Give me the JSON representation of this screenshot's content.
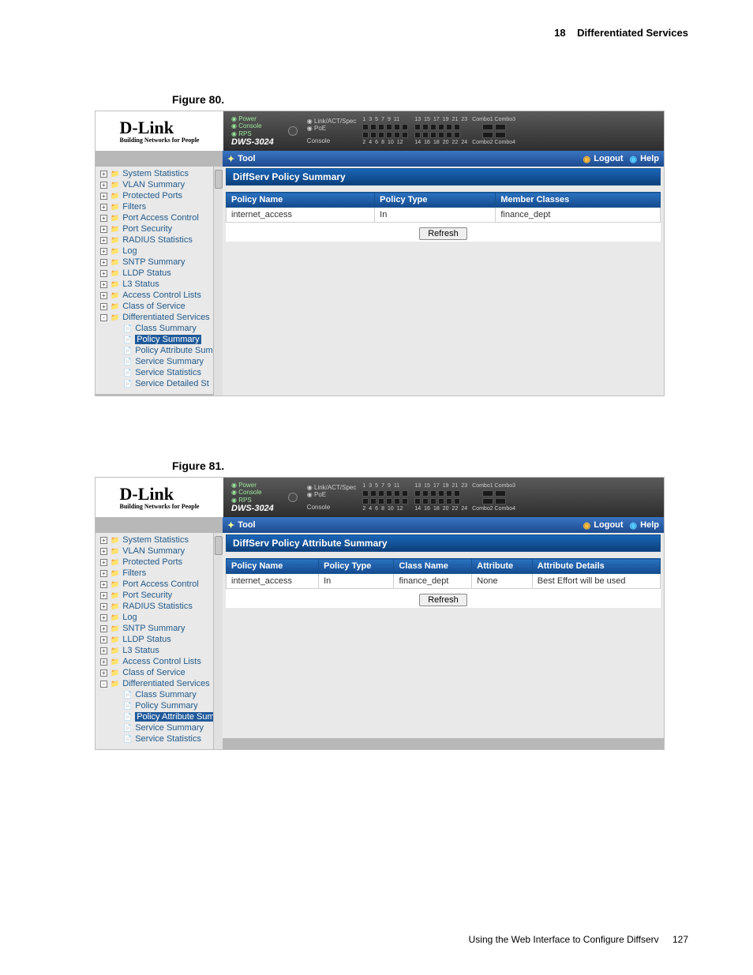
{
  "page": {
    "header_chapter_num": "18",
    "header_chapter_title": "Differentiated Services",
    "footer_text": "Using the Web Interface to Configure Diffserv",
    "footer_page": "127"
  },
  "figure80": {
    "caption": "Figure 80.",
    "brand": "D-Link",
    "tagline": "Building Networks for People",
    "model": "DWS-3024",
    "leds": {
      "power": "Power",
      "console_led": "Console",
      "rps": "RPS"
    },
    "status_col": {
      "link": "Link/ACT/Spec",
      "poe": "PoE",
      "console": "Console"
    },
    "port_row1": [
      "1",
      "3",
      "5",
      "7",
      "9",
      "11"
    ],
    "port_row2": [
      "2",
      "4",
      "6",
      "8",
      "10",
      "12"
    ],
    "port_row3": [
      "13",
      "15",
      "17",
      "19",
      "21",
      "23"
    ],
    "port_row4": [
      "14",
      "16",
      "18",
      "20",
      "22",
      "24"
    ],
    "combo1": "Combo1 Combo3",
    "combo2": "Combo2 Combo4",
    "toolbar": {
      "tool": "Tool",
      "logout": "Logout",
      "help": "Help"
    },
    "sidebar": [
      {
        "exp": "+",
        "label": "System Statistics"
      },
      {
        "exp": "+",
        "label": "VLAN Summary"
      },
      {
        "exp": "+",
        "label": "Protected Ports"
      },
      {
        "exp": "+",
        "label": "Filters"
      },
      {
        "exp": "+",
        "label": "Port Access Control"
      },
      {
        "exp": "+",
        "label": "Port Security"
      },
      {
        "exp": "+",
        "label": "RADIUS Statistics"
      },
      {
        "exp": "+",
        "label": "Log"
      },
      {
        "exp": "+",
        "label": "SNTP Summary"
      },
      {
        "exp": "+",
        "label": "LLDP Status"
      },
      {
        "exp": "+",
        "label": "L3 Status"
      },
      {
        "exp": "+",
        "label": "Access Control Lists"
      },
      {
        "exp": "+",
        "label": "Class of Service"
      },
      {
        "exp": "-",
        "label": "Differentiated Services"
      },
      {
        "exp": "",
        "label": "Class Summary",
        "child": true
      },
      {
        "exp": "",
        "label": "Policy Summary",
        "child": true,
        "selected": true
      },
      {
        "exp": "",
        "label": "Policy Attribute Sum",
        "child": true
      },
      {
        "exp": "",
        "label": "Service Summary",
        "child": true
      },
      {
        "exp": "",
        "label": "Service Statistics",
        "child": true
      },
      {
        "exp": "",
        "label": "Service Detailed St",
        "child": true
      }
    ],
    "section_title": "DiffServ Policy Summary",
    "columns": [
      "Policy Name",
      "Policy Type",
      "Member Classes"
    ],
    "rows": [
      {
        "policy_name": "internet_access",
        "policy_type": "In",
        "member_classes": "finance_dept"
      }
    ],
    "refresh": "Refresh"
  },
  "figure81": {
    "caption": "Figure 81.",
    "brand": "D-Link",
    "tagline": "Building Networks for People",
    "model": "DWS-3024",
    "leds": {
      "power": "Power",
      "console_led": "Console",
      "rps": "RPS"
    },
    "status_col": {
      "link": "Link/ACT/Spec",
      "poe": "PoE",
      "console": "Console"
    },
    "port_row1": [
      "1",
      "3",
      "5",
      "7",
      "9",
      "11"
    ],
    "port_row2": [
      "2",
      "4",
      "6",
      "8",
      "10",
      "12"
    ],
    "port_row3": [
      "13",
      "15",
      "17",
      "19",
      "21",
      "23"
    ],
    "port_row4": [
      "14",
      "16",
      "18",
      "20",
      "22",
      "24"
    ],
    "combo1": "Combo1 Combo3",
    "combo2": "Combo2 Combo4",
    "toolbar": {
      "tool": "Tool",
      "logout": "Logout",
      "help": "Help"
    },
    "sidebar": [
      {
        "exp": "+",
        "label": "System Statistics"
      },
      {
        "exp": "+",
        "label": "VLAN Summary"
      },
      {
        "exp": "+",
        "label": "Protected Ports"
      },
      {
        "exp": "+",
        "label": "Filters"
      },
      {
        "exp": "+",
        "label": "Port Access Control"
      },
      {
        "exp": "+",
        "label": "Port Security"
      },
      {
        "exp": "+",
        "label": "RADIUS Statistics"
      },
      {
        "exp": "+",
        "label": "Log"
      },
      {
        "exp": "+",
        "label": "SNTP Summary"
      },
      {
        "exp": "+",
        "label": "LLDP Status"
      },
      {
        "exp": "+",
        "label": "L3 Status"
      },
      {
        "exp": "+",
        "label": "Access Control Lists"
      },
      {
        "exp": "+",
        "label": "Class of Service"
      },
      {
        "exp": "-",
        "label": "Differentiated Services"
      },
      {
        "exp": "",
        "label": "Class Summary",
        "child": true
      },
      {
        "exp": "",
        "label": "Policy Summary",
        "child": true
      },
      {
        "exp": "",
        "label": "Policy Attribute Sum",
        "child": true,
        "selected": true
      },
      {
        "exp": "",
        "label": "Service Summary",
        "child": true
      },
      {
        "exp": "",
        "label": "Service Statistics",
        "child": true
      }
    ],
    "section_title": "DiffServ Policy Attribute Summary",
    "columns": [
      "Policy Name",
      "Policy Type",
      "Class Name",
      "Attribute",
      "Attribute Details"
    ],
    "rows": [
      {
        "policy_name": "internet_access",
        "policy_type": "In",
        "class_name": "finance_dept",
        "attribute": "None",
        "attribute_details": "Best Effort will be used"
      }
    ],
    "refresh": "Refresh"
  }
}
